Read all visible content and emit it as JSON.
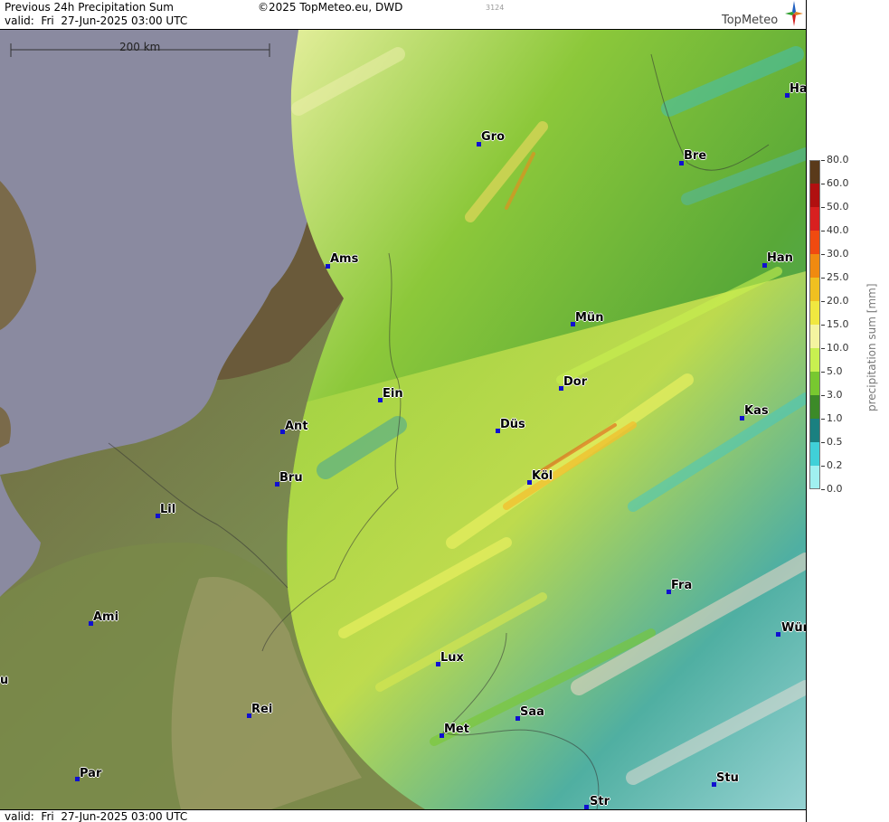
{
  "header": {
    "title": "Previous 24h Precipitation Sum",
    "valid": "valid:  Fri  27-Jun-2025 03:00 UTC",
    "copyright": "©2025 TopMeteo.eu, DWD",
    "code": "3124",
    "logo_text": "TopMeteo"
  },
  "footer": {
    "valid": "valid:  Fri  27-Jun-2025 03:00 UTC"
  },
  "map": {
    "scale_label": "200 km",
    "cities": [
      {
        "name": "Ha"
      },
      {
        "name": "Gro"
      },
      {
        "name": "Bre"
      },
      {
        "name": "Ams"
      },
      {
        "name": "Han"
      },
      {
        "name": "Mün"
      },
      {
        "name": "Ein"
      },
      {
        "name": "Dor"
      },
      {
        "name": "Kas"
      },
      {
        "name": "Ant"
      },
      {
        "name": "Düs"
      },
      {
        "name": "Bru"
      },
      {
        "name": "Köl"
      },
      {
        "name": "Lil"
      },
      {
        "name": "Fra"
      },
      {
        "name": "Ami"
      },
      {
        "name": "Wür"
      },
      {
        "name": "Lux"
      },
      {
        "name": "u"
      },
      {
        "name": "Rei"
      },
      {
        "name": "Saa"
      },
      {
        "name": "Met"
      },
      {
        "name": "Par"
      },
      {
        "name": "Stu"
      },
      {
        "name": "Str"
      }
    ]
  },
  "legend": {
    "title": "precipitation sum [mm]",
    "levels": [
      "80.0",
      "60.0",
      "50.0",
      "40.0",
      "30.0",
      "25.0",
      "20.0",
      "15.0",
      "10.0",
      "5.0",
      "3.0",
      "1.0",
      "0.5",
      "0.2",
      "0.0"
    ],
    "colors": [
      "#5a3a1a",
      "#b01010",
      "#d82020",
      "#f04a10",
      "#f08a10",
      "#f0c020",
      "#f0e840",
      "#f4f4a0",
      "#c8f050",
      "#78c830",
      "#3c8a28",
      "#1a8080",
      "#40d0d8",
      "#a0f0f0",
      "#ffffff"
    ]
  }
}
